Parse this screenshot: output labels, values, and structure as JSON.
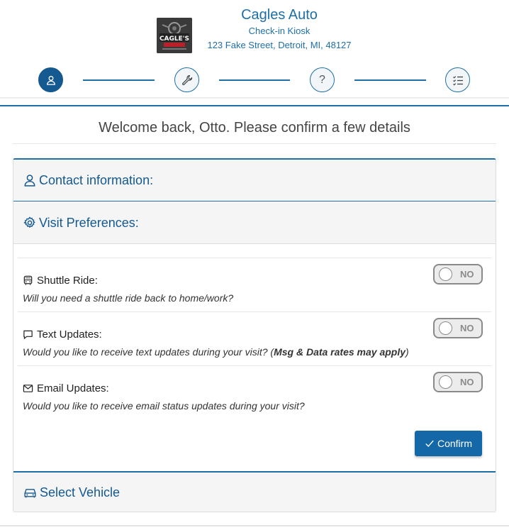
{
  "header": {
    "brand_name": "Cagles Auto",
    "subtitle": "Check-in Kiosk",
    "address": "123 Fake Street, Detroit, MI, 48127",
    "logo_text": "CAGLE'S"
  },
  "stepper": {
    "steps": [
      {
        "icon": "user-icon",
        "state": "active"
      },
      {
        "icon": "wrench-icon",
        "state": "pending"
      },
      {
        "icon": "question-icon",
        "state": "pending"
      },
      {
        "icon": "checklist-icon",
        "state": "pending"
      }
    ],
    "question_glyph": "?"
  },
  "welcome_text": "Welcome back, Otto. Please confirm a few details",
  "sections": {
    "contact": "Contact information:",
    "visit": "Visit Preferences:",
    "vehicle": "Select Vehicle"
  },
  "preferences": [
    {
      "title": "Shuttle Ride:",
      "desc": "Will you need a shuttle ride back to home/work?",
      "toggle": "NO",
      "icon": "bus-icon"
    },
    {
      "title": "Text Updates:",
      "desc_pre": "Would you like to receive text updates during your visit? (",
      "desc_bold": "Msg & Data rates may apply",
      "desc_post": ")",
      "toggle": "NO",
      "icon": "chat-icon"
    },
    {
      "title": "Email Updates:",
      "desc": "Would you like to receive email status updates during your visit?",
      "toggle": "NO",
      "icon": "envelope-icon"
    }
  ],
  "confirm_label": "Confirm",
  "colors": {
    "accent": "#1e6fa8",
    "active_step": "#14598f",
    "button": "#1568a8"
  }
}
